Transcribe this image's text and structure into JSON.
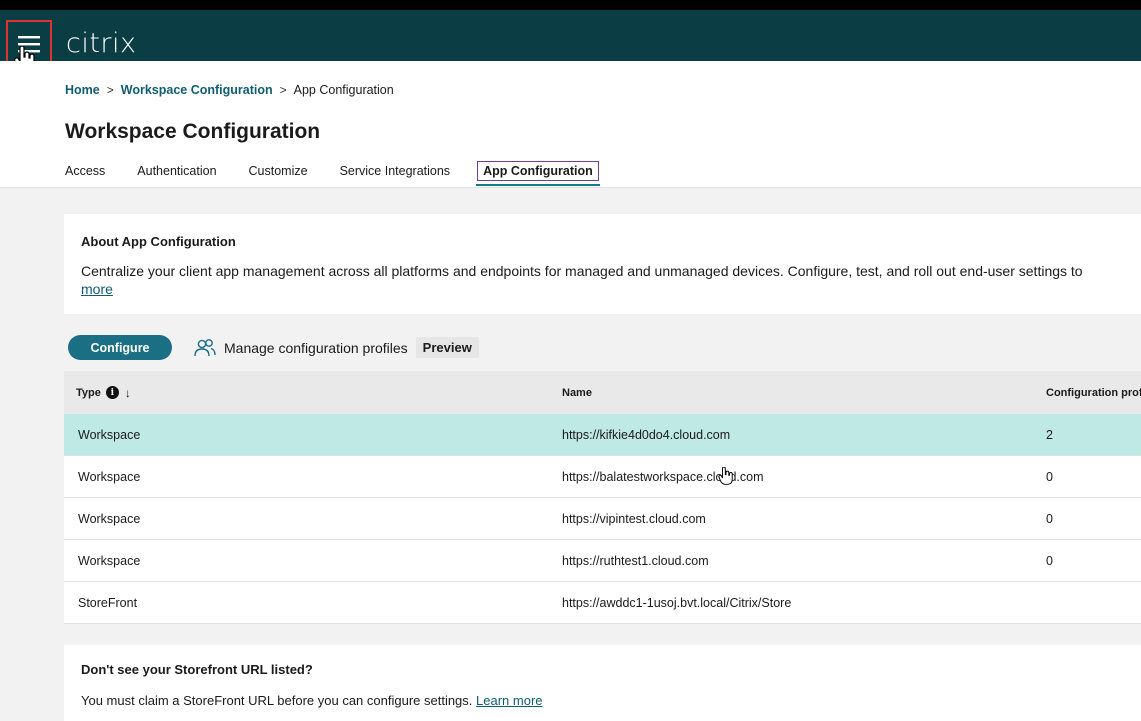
{
  "app": {
    "logo": "citrix"
  },
  "colors": {
    "topbar": "#0b3d44",
    "accent": "#1a6f85",
    "selected_row": "#bfe9e5",
    "active_tab_outline": "#6b3fa8",
    "highlight_box": "#e0322f"
  },
  "breadcrumb": {
    "home": "Home",
    "sep1": ">",
    "workspace_config": "Workspace Configuration",
    "sep2": ">",
    "current": "App Configuration"
  },
  "page": {
    "title": "Workspace Configuration"
  },
  "tabs": [
    {
      "label": "Access"
    },
    {
      "label": "Authentication"
    },
    {
      "label": "Customize"
    },
    {
      "label": "Service Integrations"
    },
    {
      "label": "App Configuration",
      "active": true
    }
  ],
  "about": {
    "title": "About App Configuration",
    "text": "Centralize your client app management across all platforms and endpoints for managed and unmanaged devices. Configure, test, and roll out end-user settings to",
    "more": "more"
  },
  "actions": {
    "configure": "Configure",
    "manage": "Manage configuration profiles",
    "preview": "Preview"
  },
  "table": {
    "headers": {
      "type": "Type",
      "info": "i",
      "sort": "↓",
      "name": "Name",
      "config": "Configuration profi"
    },
    "rows": [
      {
        "type": "Workspace",
        "name": "https://kifkie4d0do4.cloud.com",
        "config": "2",
        "selected": true
      },
      {
        "type": "Workspace",
        "name": "https://balatestworkspace.cloud.com",
        "config": "0"
      },
      {
        "type": "Workspace",
        "name": "https://vipintest.cloud.com",
        "config": "0"
      },
      {
        "type": "Workspace",
        "name": "https://ruthtest1.cloud.com",
        "config": "0"
      },
      {
        "type": "StoreFront",
        "name": "https://awddc1-1usoj.bvt.local/Citrix/Store",
        "config": ""
      }
    ]
  },
  "storefront": {
    "title": "Don't see your Storefront URL listed?",
    "text": "You must claim a StoreFront URL before you can configure settings.",
    "link": "Learn more"
  }
}
